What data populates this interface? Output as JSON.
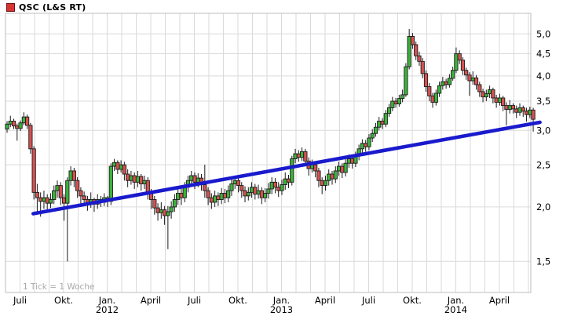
{
  "legend": {
    "title": "QSC (L&S RT)",
    "swatch_color": "#d73333"
  },
  "footnote": {
    "text": "1 Tick = 1 Woche"
  },
  "chart_data": {
    "type": "candlestick",
    "instrument": "QSC (L&S RT)",
    "tick_interval": "1 Tick = 1 Woche",
    "scale": "logarithmic",
    "colors": {
      "up": "#3bb33b",
      "down": "#d65151",
      "wick": "#1a1a1a",
      "grid": "#dadada",
      "border": "#bdbdbd",
      "trend": "#1a1acd",
      "axis_text": "#000000"
    },
    "y_axis": {
      "side": "right",
      "ticks": [
        {
          "value": 5.0,
          "label": "5,0"
        },
        {
          "value": 4.5,
          "label": "4,5"
        },
        {
          "value": 4.0,
          "label": "4,0"
        },
        {
          "value": 3.5,
          "label": "3,5"
        },
        {
          "value": 3.0,
          "label": "3,0"
        },
        {
          "value": 2.5,
          "label": "2,5"
        },
        {
          "value": 2.0,
          "label": "2,0"
        },
        {
          "value": 1.5,
          "label": "1,5"
        }
      ]
    },
    "x_axis": {
      "months_total": 36,
      "quarter_labels": [
        {
          "label": "Juli",
          "month": 1
        },
        {
          "label": "Okt.",
          "month": 4
        },
        {
          "label": "Jan.",
          "month": 7,
          "year": "2012"
        },
        {
          "label": "April",
          "month": 10
        },
        {
          "label": "Juli",
          "month": 13
        },
        {
          "label": "Okt.",
          "month": 16
        },
        {
          "label": "Jan.",
          "month": 19,
          "year": "2013"
        },
        {
          "label": "April",
          "month": 22
        },
        {
          "label": "Juli",
          "month": 25
        },
        {
          "label": "Okt.",
          "month": 28
        },
        {
          "label": "Jan.",
          "month": 31,
          "year": "2014"
        },
        {
          "label": "April",
          "month": 34
        }
      ]
    },
    "trendline": {
      "from_week": 7.8,
      "from_price": 1.93,
      "to_week": 159,
      "to_price": 3.13
    },
    "candles_format": [
      "open",
      "close",
      "low",
      "high"
    ],
    "candles": [
      [
        3.02,
        3.1,
        2.96,
        3.15
      ],
      [
        3.1,
        3.15,
        3.05,
        3.24
      ],
      [
        3.15,
        3.07,
        3.02,
        3.19
      ],
      [
        3.07,
        3.03,
        2.84,
        3.11
      ],
      [
        3.03,
        3.12,
        2.99,
        3.16
      ],
      [
        3.12,
        3.22,
        3.08,
        3.3
      ],
      [
        3.22,
        3.08,
        3.02,
        3.26
      ],
      [
        3.08,
        2.72,
        2.65,
        3.12
      ],
      [
        2.72,
        2.16,
        2.08,
        2.76
      ],
      [
        2.16,
        2.1,
        1.94,
        2.26
      ],
      [
        2.1,
        2.06,
        1.9,
        2.16
      ],
      [
        2.06,
        2.1,
        1.98,
        2.18
      ],
      [
        2.1,
        2.04,
        1.95,
        2.14
      ],
      [
        2.04,
        2.08,
        1.99,
        2.15
      ],
      [
        2.08,
        2.18,
        2.03,
        2.24
      ],
      [
        2.18,
        2.24,
        2.1,
        2.3
      ],
      [
        2.24,
        2.1,
        2.02,
        2.28
      ],
      [
        2.1,
        2.04,
        1.86,
        2.14
      ],
      [
        2.04,
        2.3,
        1.5,
        2.34
      ],
      [
        2.3,
        2.42,
        2.24,
        2.48
      ],
      [
        2.42,
        2.3,
        2.22,
        2.46
      ],
      [
        2.3,
        2.18,
        2.1,
        2.34
      ],
      [
        2.18,
        2.12,
        2.0,
        2.22
      ],
      [
        2.12,
        2.08,
        2.01,
        2.17
      ],
      [
        2.08,
        2.04,
        1.96,
        2.12
      ],
      [
        2.04,
        2.08,
        1.99,
        2.16
      ],
      [
        2.08,
        2.03,
        1.95,
        2.1
      ],
      [
        2.03,
        2.08,
        1.98,
        2.14
      ],
      [
        2.08,
        2.05,
        2.0,
        2.12
      ],
      [
        2.05,
        2.1,
        2.01,
        2.15
      ],
      [
        2.1,
        2.06,
        2.0,
        2.12
      ],
      [
        2.06,
        2.48,
        2.02,
        2.52
      ],
      [
        2.48,
        2.53,
        2.42,
        2.58
      ],
      [
        2.53,
        2.44,
        2.38,
        2.56
      ],
      [
        2.44,
        2.5,
        2.4,
        2.56
      ],
      [
        2.5,
        2.38,
        2.3,
        2.54
      ],
      [
        2.38,
        2.3,
        2.22,
        2.44
      ],
      [
        2.3,
        2.36,
        2.25,
        2.42
      ],
      [
        2.36,
        2.28,
        2.2,
        2.4
      ],
      [
        2.28,
        2.35,
        2.22,
        2.42
      ],
      [
        2.35,
        2.26,
        2.18,
        2.38
      ],
      [
        2.26,
        2.3,
        2.2,
        2.36
      ],
      [
        2.3,
        2.16,
        2.08,
        2.34
      ],
      [
        2.16,
        2.08,
        1.98,
        2.2
      ],
      [
        2.08,
        1.99,
        1.92,
        2.12
      ],
      [
        1.99,
        1.94,
        1.86,
        2.04
      ],
      [
        1.94,
        1.97,
        1.88,
        2.05
      ],
      [
        1.97,
        1.91,
        1.82,
        2.01
      ],
      [
        1.91,
        1.95,
        1.6,
        2.01
      ],
      [
        1.95,
        2.0,
        1.88,
        2.06
      ],
      [
        2.0,
        2.08,
        1.95,
        2.14
      ],
      [
        2.08,
        2.15,
        2.02,
        2.22
      ],
      [
        2.15,
        2.1,
        2.02,
        2.2
      ],
      [
        2.1,
        2.22,
        2.05,
        2.28
      ],
      [
        2.22,
        2.3,
        2.16,
        2.36
      ],
      [
        2.3,
        2.36,
        2.24,
        2.42
      ],
      [
        2.36,
        2.28,
        2.2,
        2.4
      ],
      [
        2.28,
        2.33,
        2.22,
        2.39
      ],
      [
        2.33,
        2.25,
        2.18,
        2.38
      ],
      [
        2.25,
        2.18,
        2.1,
        2.5
      ],
      [
        2.18,
        2.1,
        2.02,
        2.22
      ],
      [
        2.1,
        2.05,
        1.98,
        2.15
      ],
      [
        2.05,
        2.12,
        2.0,
        2.18
      ],
      [
        2.12,
        2.08,
        2.01,
        2.16
      ],
      [
        2.08,
        2.15,
        2.03,
        2.21
      ],
      [
        2.15,
        2.1,
        2.04,
        2.2
      ],
      [
        2.1,
        2.18,
        2.05,
        2.24
      ],
      [
        2.18,
        2.26,
        2.12,
        2.32
      ],
      [
        2.26,
        2.3,
        2.2,
        2.36
      ],
      [
        2.3,
        2.24,
        2.16,
        2.34
      ],
      [
        2.24,
        2.18,
        2.1,
        2.28
      ],
      [
        2.18,
        2.12,
        2.05,
        2.23
      ],
      [
        2.12,
        2.16,
        2.07,
        2.22
      ],
      [
        2.16,
        2.22,
        2.1,
        2.28
      ],
      [
        2.22,
        2.14,
        2.08,
        2.26
      ],
      [
        2.14,
        2.18,
        2.09,
        2.25
      ],
      [
        2.18,
        2.1,
        2.03,
        2.22
      ],
      [
        2.1,
        2.15,
        2.05,
        2.21
      ],
      [
        2.15,
        2.2,
        2.09,
        2.27
      ],
      [
        2.2,
        2.28,
        2.14,
        2.34
      ],
      [
        2.28,
        2.22,
        2.15,
        2.33
      ],
      [
        2.22,
        2.18,
        2.11,
        2.28
      ],
      [
        2.18,
        2.25,
        2.13,
        2.31
      ],
      [
        2.25,
        2.32,
        2.19,
        2.4
      ],
      [
        2.32,
        2.28,
        2.21,
        2.37
      ],
      [
        2.28,
        2.58,
        2.24,
        2.62
      ],
      [
        2.58,
        2.65,
        2.52,
        2.72
      ],
      [
        2.65,
        2.6,
        2.54,
        2.7
      ],
      [
        2.6,
        2.68,
        2.55,
        2.74
      ],
      [
        2.68,
        2.55,
        2.48,
        2.72
      ],
      [
        2.55,
        2.45,
        2.36,
        2.6
      ],
      [
        2.45,
        2.5,
        2.4,
        2.57
      ],
      [
        2.5,
        2.42,
        2.34,
        2.54
      ],
      [
        2.42,
        2.3,
        2.22,
        2.46
      ],
      [
        2.3,
        2.24,
        2.14,
        2.34
      ],
      [
        2.24,
        2.3,
        2.18,
        2.36
      ],
      [
        2.3,
        2.38,
        2.24,
        2.44
      ],
      [
        2.38,
        2.32,
        2.25,
        2.42
      ],
      [
        2.32,
        2.42,
        2.27,
        2.48
      ],
      [
        2.42,
        2.48,
        2.36,
        2.54
      ],
      [
        2.48,
        2.4,
        2.33,
        2.52
      ],
      [
        2.4,
        2.52,
        2.35,
        2.58
      ],
      [
        2.52,
        2.58,
        2.46,
        2.64
      ],
      [
        2.58,
        2.52,
        2.45,
        2.62
      ],
      [
        2.52,
        2.62,
        2.47,
        2.68
      ],
      [
        2.62,
        2.72,
        2.56,
        2.78
      ],
      [
        2.72,
        2.8,
        2.66,
        2.86
      ],
      [
        2.8,
        2.75,
        2.68,
        2.85
      ],
      [
        2.75,
        2.88,
        2.7,
        2.94
      ],
      [
        2.88,
        2.95,
        2.82,
        3.02
      ],
      [
        2.95,
        3.05,
        2.9,
        3.12
      ],
      [
        3.05,
        3.15,
        3.0,
        3.22
      ],
      [
        3.15,
        3.1,
        3.02,
        3.2
      ],
      [
        3.1,
        3.28,
        3.05,
        3.34
      ],
      [
        3.28,
        3.38,
        3.22,
        3.45
      ],
      [
        3.38,
        3.5,
        3.32,
        3.58
      ],
      [
        3.5,
        3.45,
        3.38,
        3.56
      ],
      [
        3.45,
        3.55,
        3.4,
        3.62
      ],
      [
        3.55,
        3.62,
        3.48,
        3.72
      ],
      [
        3.62,
        4.2,
        3.58,
        4.28
      ],
      [
        4.2,
        4.93,
        4.14,
        5.13
      ],
      [
        4.93,
        4.72,
        4.62,
        5.02
      ],
      [
        4.72,
        4.45,
        4.35,
        4.8
      ],
      [
        4.45,
        4.32,
        4.22,
        4.55
      ],
      [
        4.32,
        4.05,
        3.95,
        4.4
      ],
      [
        4.05,
        3.78,
        3.68,
        4.12
      ],
      [
        3.78,
        3.6,
        3.5,
        3.85
      ],
      [
        3.6,
        3.48,
        3.38,
        3.66
      ],
      [
        3.48,
        3.65,
        3.42,
        3.72
      ],
      [
        3.65,
        3.8,
        3.58,
        3.88
      ],
      [
        3.8,
        3.88,
        3.72,
        3.98
      ],
      [
        3.88,
        3.82,
        3.74,
        3.94
      ],
      [
        3.82,
        3.95,
        3.76,
        4.04
      ],
      [
        3.95,
        4.12,
        3.9,
        4.2
      ],
      [
        4.12,
        4.5,
        4.06,
        4.65
      ],
      [
        4.5,
        4.35,
        4.26,
        4.58
      ],
      [
        4.35,
        4.12,
        4.02,
        4.42
      ],
      [
        4.12,
        4.02,
        3.92,
        4.18
      ],
      [
        4.02,
        3.9,
        3.6,
        4.08
      ],
      [
        3.9,
        3.96,
        3.82,
        4.1
      ],
      [
        3.96,
        3.82,
        3.72,
        4.02
      ],
      [
        3.82,
        3.68,
        3.58,
        3.88
      ],
      [
        3.68,
        3.58,
        3.48,
        3.74
      ],
      [
        3.58,
        3.64,
        3.5,
        3.72
      ],
      [
        3.64,
        3.72,
        3.56,
        3.8
      ],
      [
        3.72,
        3.56,
        3.46,
        3.76
      ],
      [
        3.56,
        3.48,
        3.38,
        3.62
      ],
      [
        3.48,
        3.56,
        3.42,
        3.64
      ],
      [
        3.56,
        3.42,
        3.32,
        3.6
      ],
      [
        3.42,
        3.35,
        3.08,
        3.48
      ],
      [
        3.35,
        3.42,
        3.28,
        3.52
      ],
      [
        3.42,
        3.36,
        3.28,
        3.46
      ],
      [
        3.36,
        3.3,
        3.2,
        3.42
      ],
      [
        3.3,
        3.38,
        3.24,
        3.46
      ],
      [
        3.38,
        3.32,
        3.22,
        3.42
      ],
      [
        3.32,
        3.26,
        3.14,
        3.38
      ],
      [
        3.26,
        3.34,
        3.2,
        3.4
      ],
      [
        3.34,
        3.18,
        2.98,
        3.38
      ]
    ]
  }
}
